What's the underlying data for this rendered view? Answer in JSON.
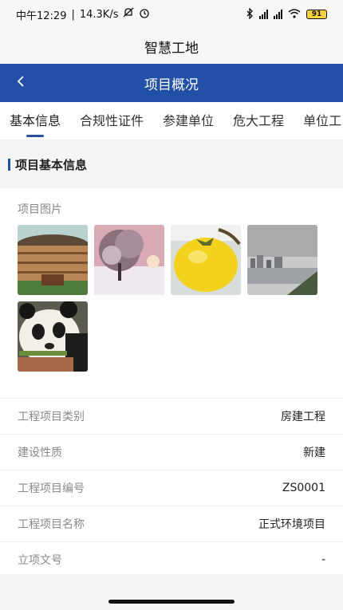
{
  "status_bar": {
    "time": "中午12:29",
    "net_speed": "14.3K/s",
    "battery": "91"
  },
  "app": {
    "title": "智慧工地"
  },
  "nav": {
    "title": "项目概况"
  },
  "tabs": [
    {
      "label": "基本信息"
    },
    {
      "label": "合规性证件"
    },
    {
      "label": "参建单位"
    },
    {
      "label": "危大工程"
    },
    {
      "label": "单位工"
    }
  ],
  "section": {
    "title": "项目基本信息"
  },
  "photos": {
    "label": "项目图片",
    "items": [
      "tulou-photo",
      "snow-tree-photo",
      "yellow-fruit-photo",
      "city-river-photo",
      "panda-photo"
    ]
  },
  "info_rows": [
    {
      "label": "工程项目类别",
      "value": "房建工程"
    },
    {
      "label": "建设性质",
      "value": "新建"
    },
    {
      "label": "工程项目编号",
      "value": "ZS0001"
    },
    {
      "label": "工程项目名称",
      "value": "正式环境项目"
    },
    {
      "label": "立项文号",
      "value": "-"
    }
  ],
  "colors": {
    "primary": "#2250a7",
    "background": "#f4f5f7"
  }
}
